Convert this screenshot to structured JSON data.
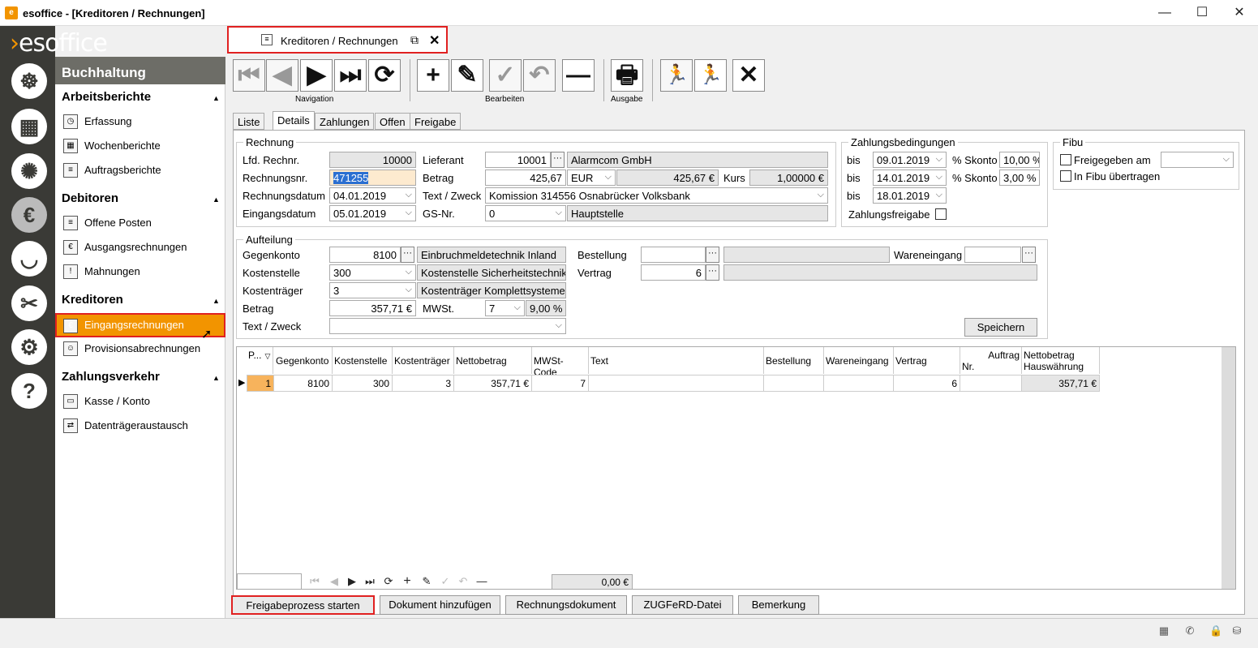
{
  "window": {
    "title": "esoffice - [Kreditoren / Rechnungen]",
    "minimize": "—",
    "maximize": "☐",
    "close": "✕"
  },
  "logo": {
    "chev": "›",
    "text": "esoffice"
  },
  "modules": [
    "☸",
    "▦",
    "✺",
    "€",
    "◡",
    "✂",
    "⚙",
    "?"
  ],
  "nav": {
    "header": "Buchhaltung",
    "sections": [
      {
        "title": "Arbeitsberichte",
        "items": [
          "Erfassung",
          "Wochenberichte",
          "Auftragsberichte"
        ]
      },
      {
        "title": "Debitoren",
        "items": [
          "Offene Posten",
          "Ausgangsrechnungen",
          "Mahnungen"
        ]
      },
      {
        "title": "Kreditoren",
        "items": [
          "Eingangsrechnungen",
          "Provisionsabrechnungen"
        ]
      },
      {
        "title": "Zahlungsverkehr",
        "items": [
          "Kasse / Konto",
          "Datenträgeraustausch"
        ]
      }
    ],
    "arrow": "▲"
  },
  "doctab": {
    "label": "Kreditoren / Rechnungen",
    "popout": "⧉",
    "close": "✕"
  },
  "toolbar": {
    "nav": [
      "⏮",
      "◀",
      "▶",
      "⏭",
      "⟳"
    ],
    "edit": [
      "+",
      "✎",
      "✓",
      "↶",
      "—"
    ],
    "print": "🖶",
    "run": [
      "🏃",
      "🏃",
      "✕"
    ],
    "labels": {
      "navigation": "Navigation",
      "bearbeiten": "Bearbeiten",
      "ausgabe": "Ausgabe"
    }
  },
  "tabs": [
    "Liste",
    "Details",
    "Zahlungen",
    "Offen",
    "Freigabe"
  ],
  "rechnung": {
    "legend": "Rechnung",
    "lfd_label": "Lfd. Rechnr.",
    "lfd": "10000",
    "nr_label": "Rechnungsnr.",
    "nr": "471255",
    "datum_label": "Rechnungsdatum",
    "datum": "04.01.2019",
    "eing_label": "Eingangsdatum",
    "eing": "05.01.2019",
    "lief_label": "Lieferant",
    "lief_nr": "10001",
    "lief_name": "Alarmcom GmbH",
    "betrag_label": "Betrag",
    "betrag": "425,67",
    "waehrung": "EUR",
    "betrag_hw": "425,67 €",
    "kurs_label": "Kurs",
    "kurs": "1,00000 €",
    "text_label": "Text / Zweck",
    "text": "Komission 314556 Osnabrücker Volksbank",
    "gs_label": "GS-Nr.",
    "gs": "0",
    "gs_name": "Hauptstelle",
    "dots": "···"
  },
  "zahlung": {
    "legend": "Zahlungsbedingungen",
    "rows": [
      {
        "bis": "bis",
        "date": "09.01.2019",
        "sk": "% Skonto",
        "val": "10,00 %"
      },
      {
        "bis": "bis",
        "date": "14.01.2019",
        "sk": "% Skonto",
        "val": "3,00 %"
      },
      {
        "bis": "bis",
        "date": "18.01.2019"
      }
    ],
    "freigabe": "Zahlungsfreigabe"
  },
  "fibu": {
    "legend": "Fibu",
    "freigegeben": "Freigegeben am",
    "uebertragen": "In Fibu übertragen"
  },
  "aufteilung": {
    "legend": "Aufteilung",
    "gk_label": "Gegenkonto",
    "gk": "8100",
    "gk_name": "Einbruchmeldetechnik Inland",
    "ks_label": "Kostenstelle",
    "ks": "300",
    "ks_name": "Kostenstelle Sicherheitstechnik",
    "kt_label": "Kostenträger",
    "kt": "3",
    "kt_name": "Kostenträger Komplettsysteme",
    "betrag_label": "Betrag",
    "betrag": "357,71 €",
    "mwst_label": "MWSt.",
    "mwst": "7",
    "mwst_pct": "9,00 %",
    "text_label": "Text / Zweck",
    "best_label": "Bestellung",
    "vertrag_label": "Vertrag",
    "vertrag": "6",
    "we_label": "Wareneingang",
    "speichern": "Speichern"
  },
  "grid": {
    "headers": [
      "P...",
      "Gegenkonto",
      "Kostenstelle",
      "Kostenträger",
      "Nettobetrag",
      "MWSt-Code",
      "Text",
      "Bestellung",
      "Wareneingang",
      "Vertrag",
      "Auftrag",
      "Nr.",
      "Nettobetrag",
      "Hauswährung"
    ],
    "sort": "▽",
    "row": {
      "p": "1",
      "gk": "8100",
      "ks": "300",
      "kt": "3",
      "netto": "357,71 €",
      "mwst": "7",
      "vertrag": "6",
      "netto_hw": "357,71 €"
    },
    "marker": "▶",
    "sum": "0,00 €",
    "gnav": [
      "⏮",
      "◀",
      "▶",
      "⏭",
      "⟳",
      "+",
      "✎",
      "✓",
      "↶",
      "—"
    ]
  },
  "buttons": [
    "Freigabeprozess starten",
    "Dokument hinzufügen",
    "Rechnungsdokument",
    "ZUGFeRD-Datei",
    "Bemerkung"
  ],
  "status": [
    "▦",
    "✆",
    "🔒",
    "⛁"
  ]
}
